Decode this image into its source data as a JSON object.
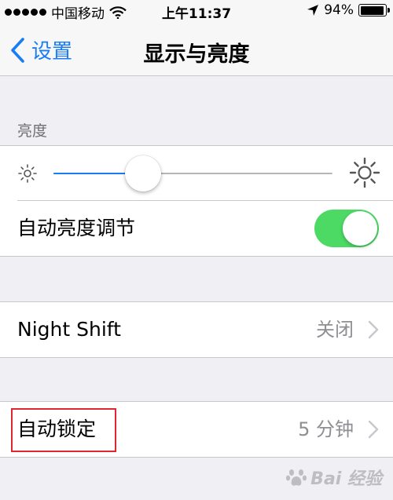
{
  "status_bar": {
    "carrier": "中国移动",
    "time": "上午11:37",
    "battery": "94%",
    "battery_level": 0.94
  },
  "nav": {
    "back_label": "设置",
    "title": "显示与亮度"
  },
  "brightness": {
    "header": "亮度",
    "level": 0.32,
    "auto_label": "自动亮度调节",
    "auto_enabled": true
  },
  "night_shift": {
    "label": "Night Shift",
    "value": "关闭"
  },
  "auto_lock": {
    "label": "自动锁定",
    "value": "5 分钟"
  },
  "watermark": {
    "text": "Bai 经验"
  },
  "colors": {
    "accent": "#1a7cf5",
    "toggle_on": "#4cd964",
    "highlight": "#e0262f"
  }
}
